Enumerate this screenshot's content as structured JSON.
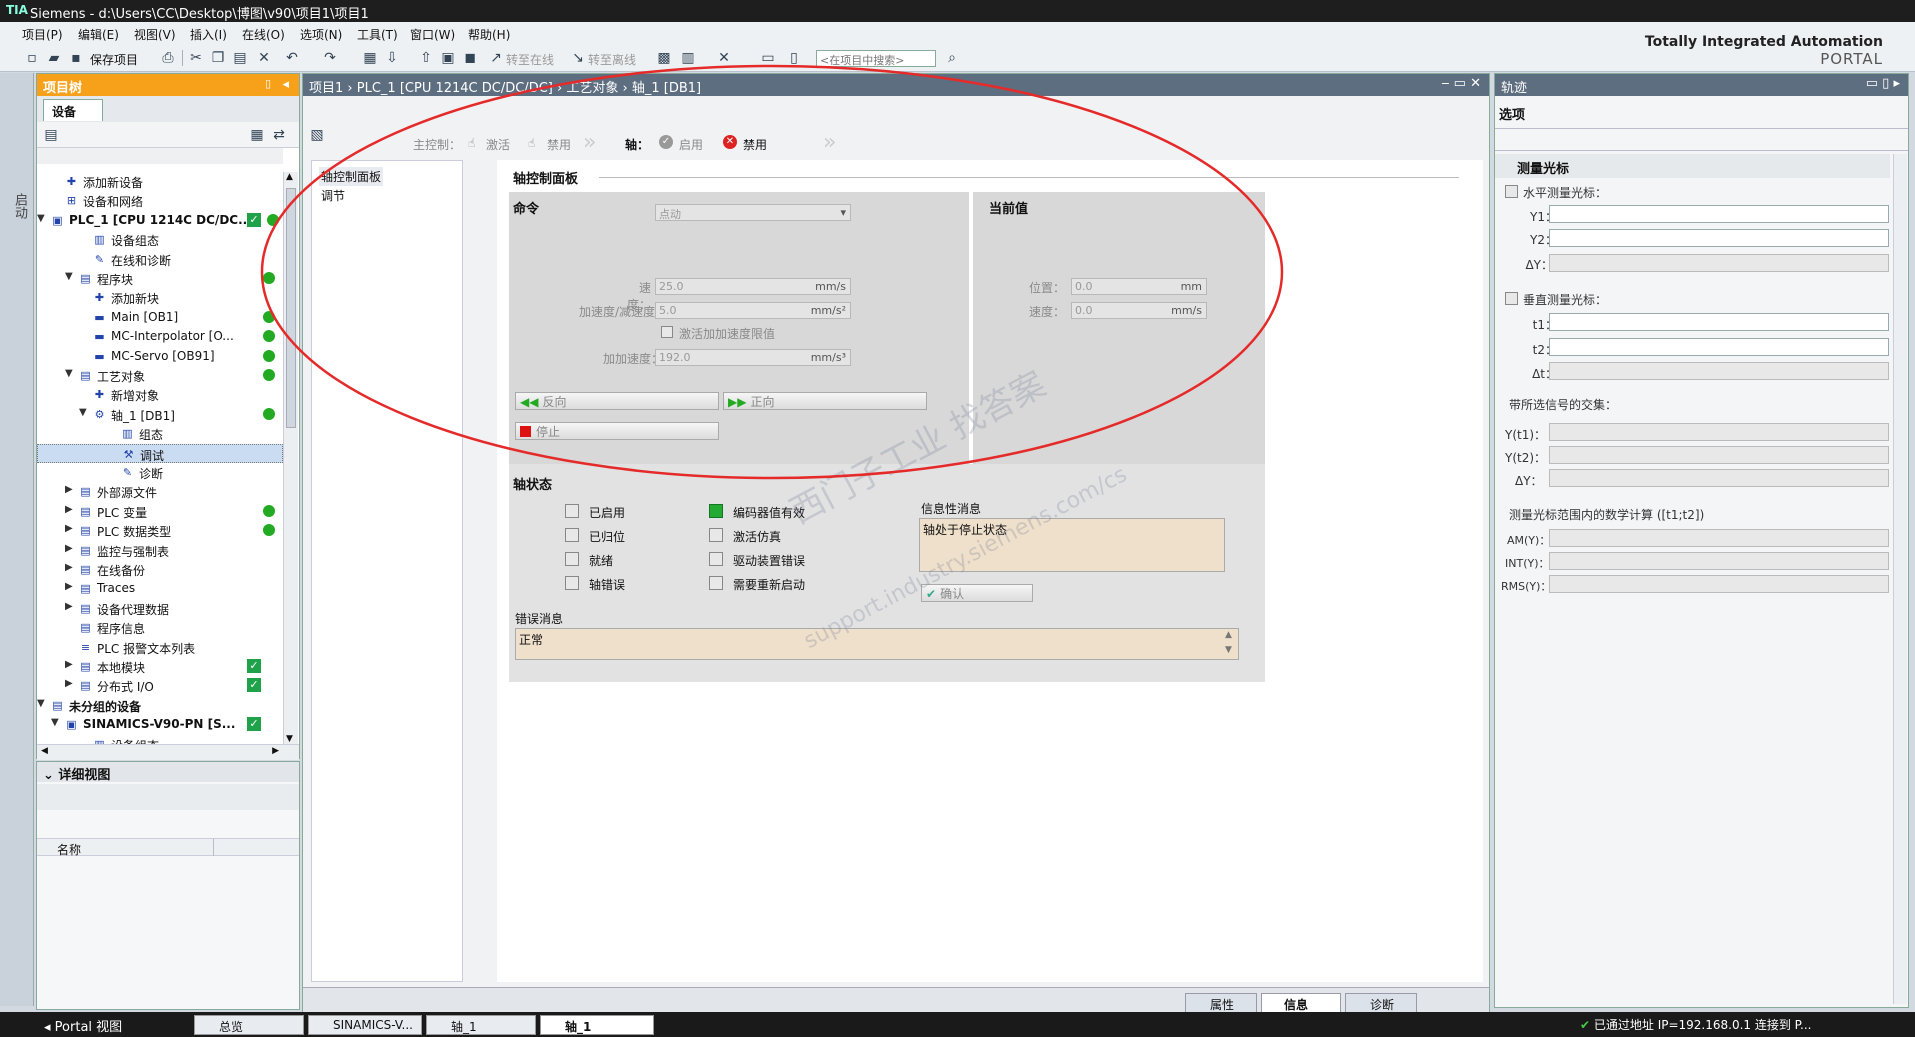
{
  "window": {
    "logo": "TIA",
    "title": "Siemens  -  d:\\Users\\CC\\Desktop\\博图\\v90\\项目1\\项目1"
  },
  "menu": [
    "项目(P)",
    "编辑(E)",
    "视图(V)",
    "插入(I)",
    "在线(O)",
    "选项(N)",
    "工具(T)",
    "窗口(W)",
    "帮助(H)"
  ],
  "toolbar": {
    "save_label": "保存项目",
    "go_online": "转至在线",
    "go_offline": "转至离线",
    "search_placeholder": "<在项目中搜索>"
  },
  "brand": {
    "line1": "Totally Integrated Automation",
    "line2": "PORTAL"
  },
  "left_strip": {
    "label": "启动"
  },
  "project_tree": {
    "title": "项目树",
    "tab": "设备",
    "items": [
      {
        "label": "添加新设备"
      },
      {
        "label": "设备和网络"
      },
      {
        "label": "PLC_1 [CPU 1214C DC/DC..."
      },
      {
        "label": "设备组态"
      },
      {
        "label": "在线和诊断"
      },
      {
        "label": "程序块"
      },
      {
        "label": "添加新块"
      },
      {
        "label": "Main [OB1]"
      },
      {
        "label": "MC-Interpolator [O..."
      },
      {
        "label": "MC-Servo [OB91]"
      },
      {
        "label": "工艺对象"
      },
      {
        "label": "新增对象"
      },
      {
        "label": "轴_1 [DB1]"
      },
      {
        "label": "组态"
      },
      {
        "label": "调试"
      },
      {
        "label": "诊断"
      },
      {
        "label": "外部源文件"
      },
      {
        "label": "PLC 变量"
      },
      {
        "label": "PLC 数据类型"
      },
      {
        "label": "监控与强制表"
      },
      {
        "label": "在线备份"
      },
      {
        "label": "Traces"
      },
      {
        "label": "设备代理数据"
      },
      {
        "label": "程序信息"
      },
      {
        "label": "PLC 报警文本列表"
      },
      {
        "label": "本地模块"
      },
      {
        "label": "分布式 I/O"
      },
      {
        "label": "未分组的设备"
      },
      {
        "label": "SINAMICS-V90-PN [S..."
      },
      {
        "label": "设备组态"
      }
    ]
  },
  "detail_view": {
    "title": "详细视图",
    "col_name": "名称"
  },
  "editor": {
    "breadcrumb": [
      "项目1",
      "PLC_1 [CPU 1214C DC/DC/DC]",
      "工艺对象",
      "轴_1 [DB1]"
    ],
    "master_label": "主控制：",
    "activate": "激活",
    "disable": "禁用",
    "axis_label": "轴：",
    "enable": "启用",
    "disable2": "禁用",
    "nav": [
      "轴控制面板",
      "调节"
    ],
    "panel_title": "轴控制面板",
    "command": {
      "title": "命令",
      "mode": "点动",
      "speed_lbl": "速度：",
      "speed": "25.0",
      "speed_unit": "mm/s",
      "acc_lbl": "加速度/减速度：",
      "acc": "5.0",
      "acc_unit": "mm/s²",
      "jerk_cb": "激活加加速度限值",
      "jerk_lbl": "加加速度：",
      "jerk": "192.0",
      "jerk_unit": "mm/s³",
      "back": "反向",
      "fwd": "正向",
      "stop": "停止"
    },
    "current": {
      "title": "当前值",
      "pos_lbl": "位置：",
      "pos": "0.0",
      "pos_unit": "mm",
      "spd_lbl": "速度：",
      "spd": "0.0",
      "spd_unit": "mm/s"
    },
    "status": {
      "title": "轴状态",
      "flags": [
        "已启用",
        "已归位",
        "就绪",
        "轴错误",
        "编码器值有效",
        "激活仿真",
        "驱动装置错误",
        "需要重新启动"
      ],
      "info_lbl": "信息性消息",
      "info": "轴处于停止状态",
      "ack": "确认",
      "err_lbl": "错误消息",
      "err": "正常"
    },
    "bottom_tabs": [
      "属性",
      "信息",
      "诊断"
    ]
  },
  "right": {
    "title": "轨迹",
    "options": "选项",
    "section": "测量光标",
    "h_cursor": "水平测量光标：",
    "y1": "Y1：",
    "y2": "Y2：",
    "dy": "ΔY：",
    "v_cursor": "垂直测量光标：",
    "t1": "t1：",
    "t2": "t2：",
    "dt": "Δt：",
    "intersect": "带所选信号的交集：",
    "yt1": "Y(t1)：",
    "yt2": "Y(t2)：",
    "dy2": "ΔY：",
    "calc": "测量光标范围内的数学计算 ([t1;t2])",
    "am": "AM(Y)：",
    "int": "INT(Y)：",
    "rms": "RMS(Y)："
  },
  "watermark": {
    "line1": "西门子工业  找答案",
    "line2": "support.industry.siemens.com/cs"
  },
  "status_bar": {
    "portal": "Portal 视图",
    "tabs": [
      "总览",
      "SINAMICS-V...",
      "轴_1",
      "轴_1"
    ],
    "msg": "已通过地址 IP=192.168.0.1 连接到 P..."
  },
  "colors": {
    "accent": "#f7a11a",
    "annotation": "#e52a2a"
  }
}
